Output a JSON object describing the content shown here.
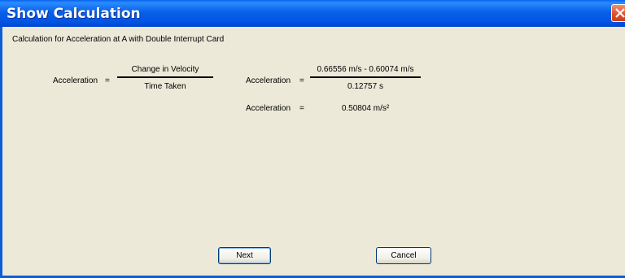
{
  "window": {
    "title": "Show Calculation"
  },
  "caption": "Calculation for Acceleration at A with Double Interrupt Card",
  "formula": {
    "label": "Acceleration",
    "equals": "=",
    "numerator": "Change in Velocity",
    "denominator": "Time Taken"
  },
  "substitution": {
    "label": "Acceleration",
    "equals": "=",
    "numerator": "0.66556 m/s - 0.60074 m/s",
    "denominator": "0.12757 s"
  },
  "result": {
    "label": "Acceleration",
    "equals": "=",
    "value": "0.50804 m/s²"
  },
  "buttons": {
    "next": "Next",
    "cancel": "Cancel"
  },
  "icons": {
    "close": "close-icon"
  },
  "colors": {
    "titlebar": "#0055e5",
    "background": "#ece9d8",
    "close": "#de4d25"
  }
}
